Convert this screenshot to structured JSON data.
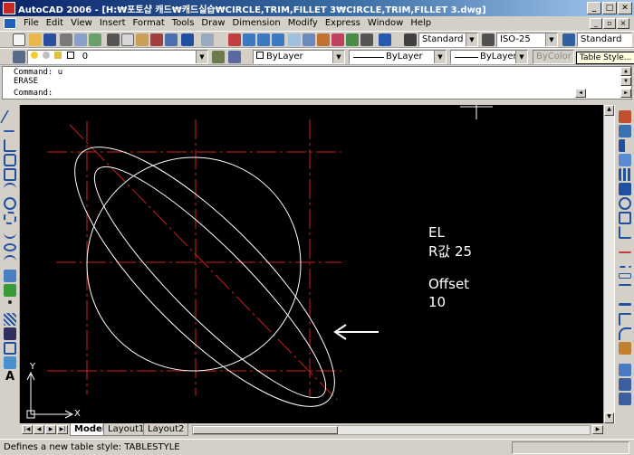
{
  "window": {
    "title": "AutoCAD 2006 - [H:₩포토샵 캐드₩캐드실습₩CIRCLE,TRIM,FILLET 3₩CIRCLE,TRIM,FILLET 3.dwg]",
    "minimize": "_",
    "maximize": "□",
    "close": "✕"
  },
  "menu": [
    "File",
    "Edit",
    "View",
    "Insert",
    "Format",
    "Tools",
    "Draw",
    "Dimension",
    "Modify",
    "Express",
    "Window",
    "Help"
  ],
  "styles": {
    "text_style": "Standard",
    "dim_style": "ISO-25",
    "table_style": "Standard",
    "tooltip": "Table Style..."
  },
  "properties": {
    "layer": "0",
    "color": "ByLayer",
    "linetype": "ByLayer",
    "lineweight": "ByLayer",
    "plot_style": "ByColor"
  },
  "command": {
    "line1": "Command: u",
    "line2": "ERASE",
    "prompt": "Command:"
  },
  "annotations": {
    "line1": "EL",
    "line2": "R값 25",
    "line3": "Offset",
    "line4": "10"
  },
  "ucs": {
    "x_label": "X",
    "y_label": "Y"
  },
  "tabs": [
    "Model",
    "Layout1",
    "Layout2"
  ],
  "status": "Defines a new table style: TABLESTYLE",
  "colors": {
    "canvas_bg": "#000000",
    "entity": "#ffffff",
    "centerline": "#cc1f1f",
    "titlebar_start": "#0a246a"
  }
}
